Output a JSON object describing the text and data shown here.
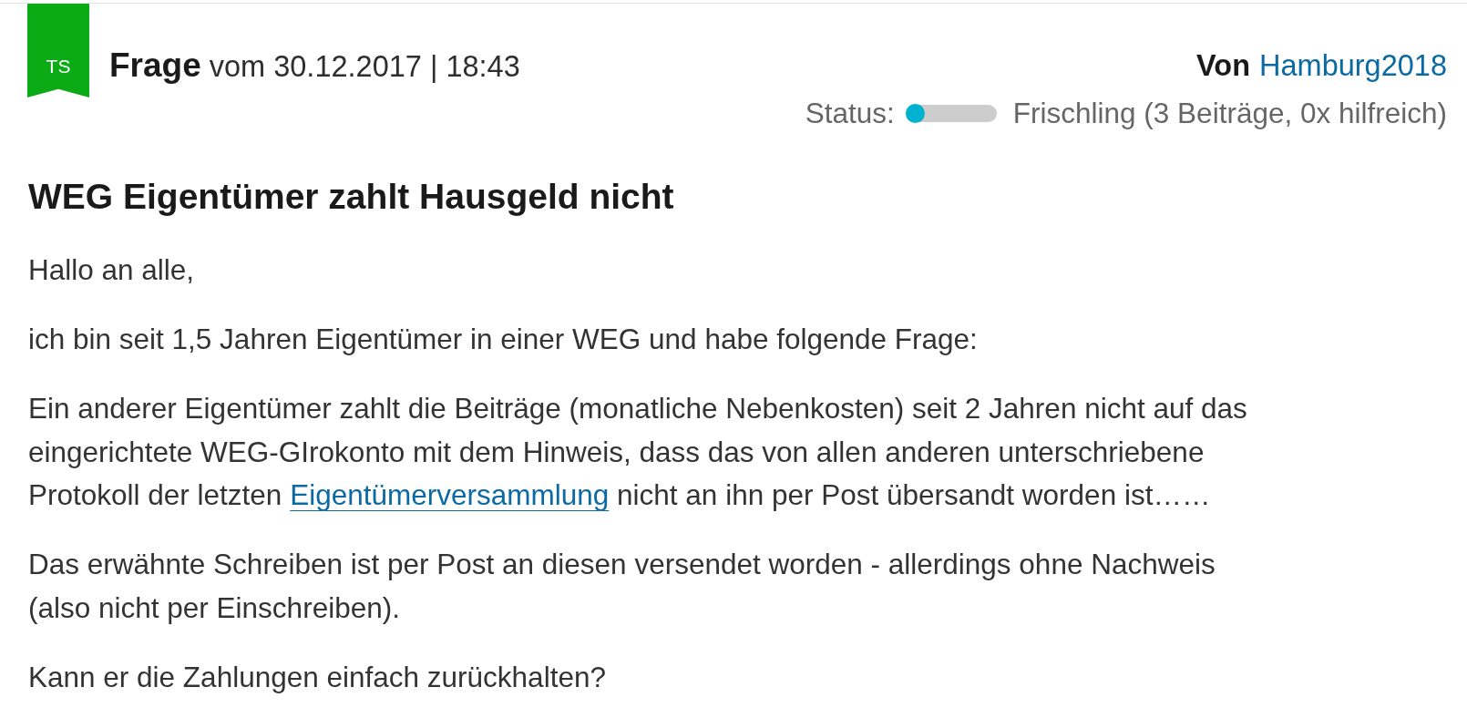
{
  "post": {
    "badge": "TS",
    "heading": "**Frage** vom 30.12.2017 | 18:43"
  },
  "author": {
    "label": "Von",
    "name": "Hamburg2018"
  },
  "status": {
    "label": "Status:",
    "level": 0.0,
    "rank": "Frischling (3 Beiträge, 0x hilfreich)"
  },
  "title": "WEG Eigentümer zahlt Hausgeld nicht",
  "paragraphs": [
    {
      "segments": [
        {
          "kind": "text",
          "text": "Hallo an alle,"
        }
      ]
    },
    {
      "segments": [
        {
          "kind": "text",
          "text": "ich bin seit 1,5 Jahren Eigentümer in einer WEG und habe folgende Frage:"
        }
      ]
    },
    {
      "segments": [
        {
          "kind": "text",
          "text": "Ein anderer Eigentümer zahlt die Beiträge (monatliche Nebenkosten) seit 2 Jahren nicht auf das eingerichtete WEG-GIrokonto mit dem Hinweis, dass das von allen anderen unterschriebene Protokoll der letzten "
        },
        {
          "kind": "link",
          "text": "Eigentümerversammlung"
        },
        {
          "kind": "text",
          "text": " nicht an ihn per Post übersandt worden ist……"
        }
      ]
    },
    {
      "segments": [
        {
          "kind": "text",
          "text": "Das erwähnte Schreiben ist per Post an diesen versendet worden - allerdings ohne Nachweis (also nicht per Einschreiben)."
        }
      ]
    },
    {
      "segments": [
        {
          "kind": "text",
          "text": "Kann er die Zahlungen einfach zurückhalten?"
        }
      ]
    }
  ]
}
